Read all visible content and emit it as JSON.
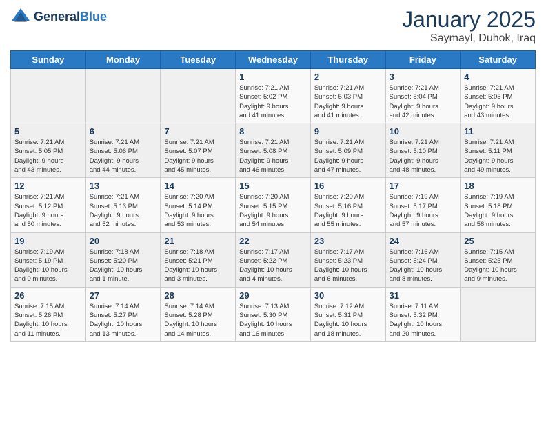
{
  "header": {
    "logo_line1": "General",
    "logo_line2": "Blue",
    "title": "January 2025",
    "subtitle": "Saymayl, Duhok, Iraq"
  },
  "days_of_week": [
    "Sunday",
    "Monday",
    "Tuesday",
    "Wednesday",
    "Thursday",
    "Friday",
    "Saturday"
  ],
  "weeks": [
    [
      {
        "day": "",
        "info": ""
      },
      {
        "day": "",
        "info": ""
      },
      {
        "day": "",
        "info": ""
      },
      {
        "day": "1",
        "info": "Sunrise: 7:21 AM\nSunset: 5:02 PM\nDaylight: 9 hours\nand 41 minutes."
      },
      {
        "day": "2",
        "info": "Sunrise: 7:21 AM\nSunset: 5:03 PM\nDaylight: 9 hours\nand 41 minutes."
      },
      {
        "day": "3",
        "info": "Sunrise: 7:21 AM\nSunset: 5:04 PM\nDaylight: 9 hours\nand 42 minutes."
      },
      {
        "day": "4",
        "info": "Sunrise: 7:21 AM\nSunset: 5:05 PM\nDaylight: 9 hours\nand 43 minutes."
      }
    ],
    [
      {
        "day": "5",
        "info": "Sunrise: 7:21 AM\nSunset: 5:05 PM\nDaylight: 9 hours\nand 43 minutes."
      },
      {
        "day": "6",
        "info": "Sunrise: 7:21 AM\nSunset: 5:06 PM\nDaylight: 9 hours\nand 44 minutes."
      },
      {
        "day": "7",
        "info": "Sunrise: 7:21 AM\nSunset: 5:07 PM\nDaylight: 9 hours\nand 45 minutes."
      },
      {
        "day": "8",
        "info": "Sunrise: 7:21 AM\nSunset: 5:08 PM\nDaylight: 9 hours\nand 46 minutes."
      },
      {
        "day": "9",
        "info": "Sunrise: 7:21 AM\nSunset: 5:09 PM\nDaylight: 9 hours\nand 47 minutes."
      },
      {
        "day": "10",
        "info": "Sunrise: 7:21 AM\nSunset: 5:10 PM\nDaylight: 9 hours\nand 48 minutes."
      },
      {
        "day": "11",
        "info": "Sunrise: 7:21 AM\nSunset: 5:11 PM\nDaylight: 9 hours\nand 49 minutes."
      }
    ],
    [
      {
        "day": "12",
        "info": "Sunrise: 7:21 AM\nSunset: 5:12 PM\nDaylight: 9 hours\nand 50 minutes."
      },
      {
        "day": "13",
        "info": "Sunrise: 7:21 AM\nSunset: 5:13 PM\nDaylight: 9 hours\nand 52 minutes."
      },
      {
        "day": "14",
        "info": "Sunrise: 7:20 AM\nSunset: 5:14 PM\nDaylight: 9 hours\nand 53 minutes."
      },
      {
        "day": "15",
        "info": "Sunrise: 7:20 AM\nSunset: 5:15 PM\nDaylight: 9 hours\nand 54 minutes."
      },
      {
        "day": "16",
        "info": "Sunrise: 7:20 AM\nSunset: 5:16 PM\nDaylight: 9 hours\nand 55 minutes."
      },
      {
        "day": "17",
        "info": "Sunrise: 7:19 AM\nSunset: 5:17 PM\nDaylight: 9 hours\nand 57 minutes."
      },
      {
        "day": "18",
        "info": "Sunrise: 7:19 AM\nSunset: 5:18 PM\nDaylight: 9 hours\nand 58 minutes."
      }
    ],
    [
      {
        "day": "19",
        "info": "Sunrise: 7:19 AM\nSunset: 5:19 PM\nDaylight: 10 hours\nand 0 minutes."
      },
      {
        "day": "20",
        "info": "Sunrise: 7:18 AM\nSunset: 5:20 PM\nDaylight: 10 hours\nand 1 minute."
      },
      {
        "day": "21",
        "info": "Sunrise: 7:18 AM\nSunset: 5:21 PM\nDaylight: 10 hours\nand 3 minutes."
      },
      {
        "day": "22",
        "info": "Sunrise: 7:17 AM\nSunset: 5:22 PM\nDaylight: 10 hours\nand 4 minutes."
      },
      {
        "day": "23",
        "info": "Sunrise: 7:17 AM\nSunset: 5:23 PM\nDaylight: 10 hours\nand 6 minutes."
      },
      {
        "day": "24",
        "info": "Sunrise: 7:16 AM\nSunset: 5:24 PM\nDaylight: 10 hours\nand 8 minutes."
      },
      {
        "day": "25",
        "info": "Sunrise: 7:15 AM\nSunset: 5:25 PM\nDaylight: 10 hours\nand 9 minutes."
      }
    ],
    [
      {
        "day": "26",
        "info": "Sunrise: 7:15 AM\nSunset: 5:26 PM\nDaylight: 10 hours\nand 11 minutes."
      },
      {
        "day": "27",
        "info": "Sunrise: 7:14 AM\nSunset: 5:27 PM\nDaylight: 10 hours\nand 13 minutes."
      },
      {
        "day": "28",
        "info": "Sunrise: 7:14 AM\nSunset: 5:28 PM\nDaylight: 10 hours\nand 14 minutes."
      },
      {
        "day": "29",
        "info": "Sunrise: 7:13 AM\nSunset: 5:30 PM\nDaylight: 10 hours\nand 16 minutes."
      },
      {
        "day": "30",
        "info": "Sunrise: 7:12 AM\nSunset: 5:31 PM\nDaylight: 10 hours\nand 18 minutes."
      },
      {
        "day": "31",
        "info": "Sunrise: 7:11 AM\nSunset: 5:32 PM\nDaylight: 10 hours\nand 20 minutes."
      },
      {
        "day": "",
        "info": ""
      }
    ]
  ]
}
